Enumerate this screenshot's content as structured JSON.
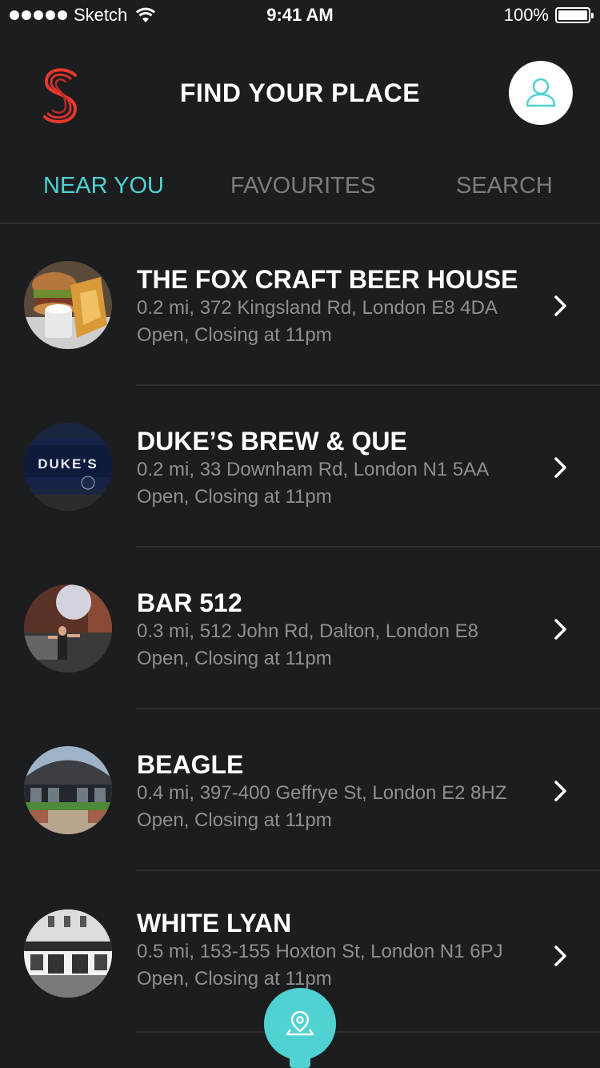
{
  "status_bar": {
    "carrier": "Sketch",
    "time": "9:41 AM",
    "battery": "100%"
  },
  "header": {
    "title": "FIND YOUR PLACE",
    "logo_icon": "s-logo-icon",
    "profile_icon": "user-icon"
  },
  "tabs": [
    {
      "label": "NEAR YOU",
      "active": true
    },
    {
      "label": "FAVOURITES",
      "active": false
    },
    {
      "label": "SEARCH",
      "active": false
    }
  ],
  "places": [
    {
      "name": "THE FOX CRAFT BEER HOUSE",
      "address": "0.2 mi, 372 Kingsland Rd, London E8 4DA",
      "status": "Open, Closing at 11pm"
    },
    {
      "name": "DUKE’S BREW & QUE",
      "address": "0.2 mi, 33 Downham Rd, London N1 5AA",
      "status": "Open, Closing at 11pm"
    },
    {
      "name": "BAR 512",
      "address": "0.3 mi, 512 John Rd, Dalton, London E8",
      "status": "Open, Closing at 11pm"
    },
    {
      "name": "BEAGLE",
      "address": "0.4 mi, 397-400 Geffrye St, London E2 8HZ",
      "status": "Open, Closing at 11pm"
    },
    {
      "name": "WHITE LYAN",
      "address": "0.5 mi, 153-155 Hoxton St, London N1 6PJ",
      "status": "Open, Closing at 11pm"
    }
  ],
  "thumbnail_signs": {
    "dukes": "DUKE'S"
  },
  "colors": {
    "accent": "#4fd2d1",
    "background": "#1c1d1f",
    "muted_text": "#8e8f93",
    "inactive_tab": "#7b7c80",
    "logo_red": "#e8392f"
  },
  "fab_icon": "map-pin-icon"
}
